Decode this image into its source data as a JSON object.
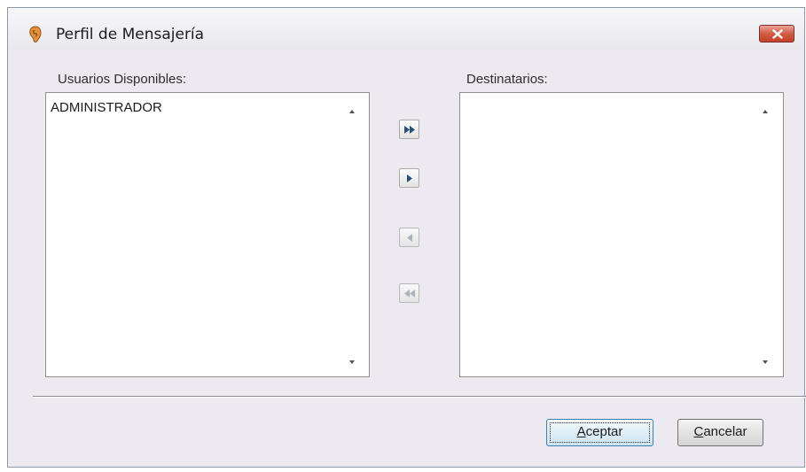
{
  "window": {
    "title": "Perfil de Mensajería"
  },
  "available": {
    "label": "Usuarios Disponibles:",
    "items": [
      "ADMINISTRADOR"
    ]
  },
  "recipients": {
    "label": "Destinatarios:",
    "items": []
  },
  "transfer": {
    "add_all": "add-all-icon",
    "add_one": "add-one-icon",
    "remove_one": "remove-one-icon",
    "remove_all": "remove-all-icon"
  },
  "buttons": {
    "accept_first": "A",
    "accept_rest": "ceptar",
    "cancel_first": "C",
    "cancel_rest": "ancelar"
  }
}
